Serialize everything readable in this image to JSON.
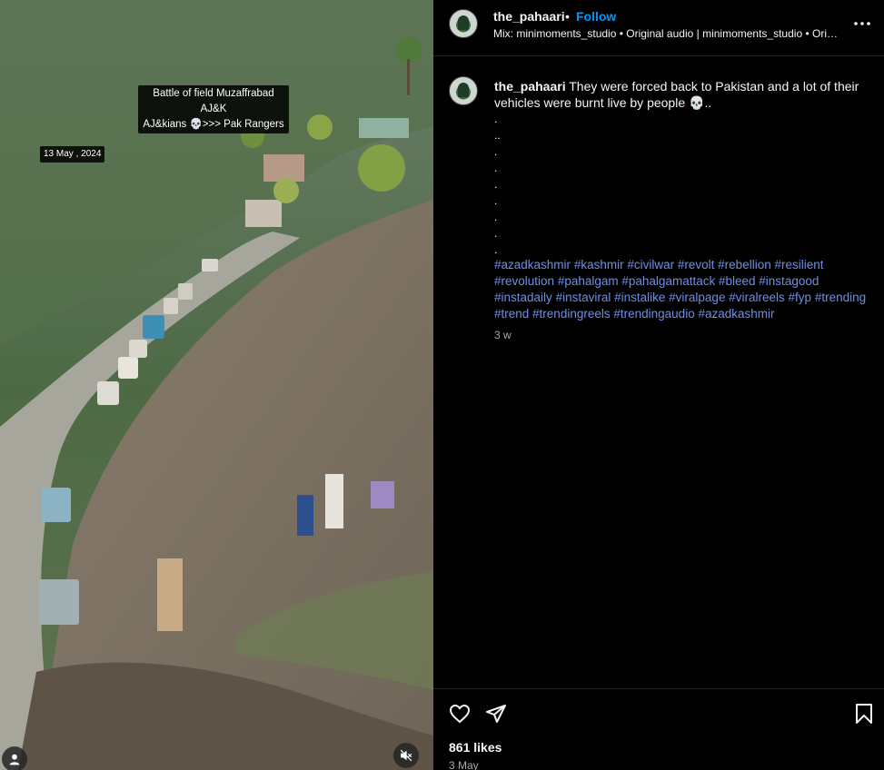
{
  "media": {
    "overlay_caption_line1": "Battle of field Muzaffrabad AJ&K",
    "overlay_caption_line2": "AJ&kians 💀>>> Pak Rangers",
    "overlay_date": "13 May , 2024",
    "user_icon": "user-icon",
    "mute_icon": "speaker-muted-icon"
  },
  "header": {
    "username": "the_pahaari",
    "separator": "•",
    "follow_label": "Follow",
    "audio_text": "Mix: minimoments_studio • Original audio | minimoments_studio • Original audio",
    "more_icon": "more-horizontal-icon"
  },
  "caption": {
    "username": "the_pahaari",
    "text": "They were forced back to Pakistan and a lot of their vehicles were burnt live by people 💀..",
    "dots": [
      ".",
      "..",
      ".",
      ".",
      ".",
      ".",
      ".",
      ".",
      "."
    ],
    "hashtags": [
      "#azadkashmir",
      "#kashmir",
      "#civilwar",
      "#revolt",
      "#rebellion",
      "#resilient",
      "#revolution",
      "#pahalgam",
      "#pahalgamattack",
      "#bleed",
      "#instagood",
      "#instadaily",
      "#instaviral",
      "#instalike",
      "#viralpage",
      "#viralreels",
      "#fyp",
      "#trending",
      "#trend",
      "#trendingreels",
      "#trendingaudio",
      "#azadkashmir"
    ],
    "time": "3 w"
  },
  "actions": {
    "like_icon": "heart-icon",
    "share_icon": "send-icon",
    "save_icon": "bookmark-icon",
    "likes": "861 likes",
    "date": "3 May"
  },
  "colors": {
    "background": "#000000",
    "link": "#0095f6",
    "hashtag": "#6c8fe6",
    "muted_text": "#a8a8a8"
  }
}
